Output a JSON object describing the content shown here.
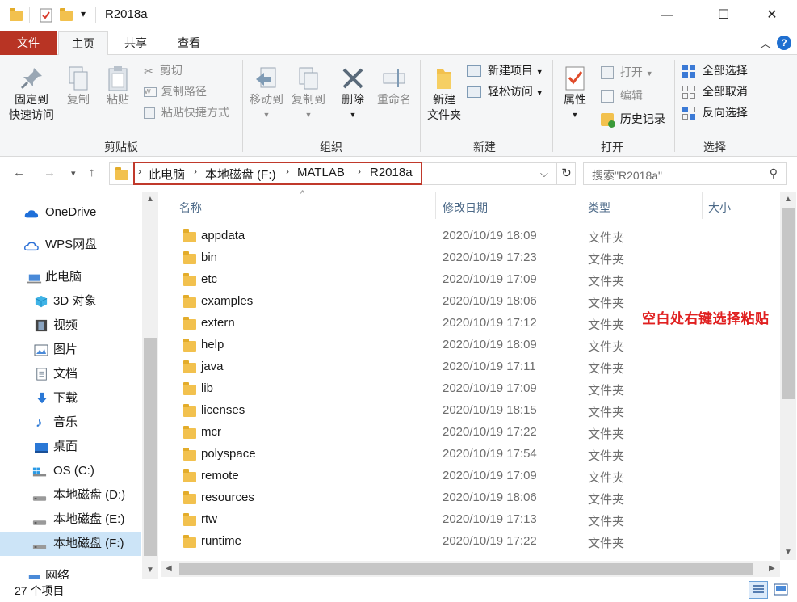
{
  "window": {
    "title": "R2018a",
    "qat_dropdown": "▾",
    "min": "—",
    "max": "☐",
    "close": "✕"
  },
  "ribbon_tabs": {
    "file": "文件",
    "home": "主页",
    "share": "共享",
    "view": "查看"
  },
  "ribbon": {
    "clipboard": {
      "pin": "固定到\n快速访问",
      "pin_line1": "固定到",
      "pin_line2": "快速访问",
      "copy": "复制",
      "paste": "粘贴",
      "cut": "剪切",
      "copy_path": "复制路径",
      "paste_shortcut": "粘贴快捷方式",
      "label": "剪贴板"
    },
    "organize": {
      "move_to": "移动到",
      "copy_to": "复制到",
      "delete": "删除",
      "rename": "重命名",
      "label": "组织"
    },
    "new": {
      "new_folder_line1": "新建",
      "new_folder_line2": "文件夹",
      "new_item": "新建项目",
      "easy_access": "轻松访问",
      "label": "新建"
    },
    "open": {
      "properties": "属性",
      "open": "打开",
      "edit": "编辑",
      "history": "历史记录",
      "label": "打开"
    },
    "select": {
      "select_all": "全部选择",
      "select_none": "全部取消",
      "invert": "反向选择",
      "label": "选择"
    }
  },
  "address": {
    "crumbs": [
      "此电脑",
      "本地磁盘 (F:)",
      "MATLAB",
      "R2018a"
    ],
    "search_placeholder": "搜索\"R2018a\""
  },
  "nav_pane": {
    "items": [
      {
        "label": "OneDrive",
        "icon": "cloud-blue-icon"
      },
      {
        "label": "WPS网盘",
        "icon": "cloud-outline-icon"
      },
      {
        "label": "此电脑",
        "icon": "computer-icon"
      },
      {
        "label": "3D 对象",
        "icon": "cube-icon"
      },
      {
        "label": "视频",
        "icon": "film-icon"
      },
      {
        "label": "图片",
        "icon": "picture-icon"
      },
      {
        "label": "文档",
        "icon": "document-icon"
      },
      {
        "label": "下载",
        "icon": "download-icon"
      },
      {
        "label": "音乐",
        "icon": "music-icon"
      },
      {
        "label": "桌面",
        "icon": "desktop-icon"
      },
      {
        "label": "OS (C:)",
        "icon": "windows-drive-icon"
      },
      {
        "label": "本地磁盘 (D:)",
        "icon": "drive-icon"
      },
      {
        "label": "本地磁盘 (E:)",
        "icon": "drive-icon"
      },
      {
        "label": "本地磁盘 (F:)",
        "icon": "drive-icon"
      },
      {
        "label": "网络",
        "icon": "network-icon"
      }
    ],
    "selected": "本地磁盘 (F:)"
  },
  "file_list": {
    "columns": {
      "name": "名称",
      "date": "修改日期",
      "type": "类型",
      "size": "大小"
    },
    "rows": [
      {
        "name": "appdata",
        "date": "2020/10/19 18:09",
        "type": "文件夹"
      },
      {
        "name": "bin",
        "date": "2020/10/19 17:23",
        "type": "文件夹"
      },
      {
        "name": "etc",
        "date": "2020/10/19 17:09",
        "type": "文件夹"
      },
      {
        "name": "examples",
        "date": "2020/10/19 18:06",
        "type": "文件夹"
      },
      {
        "name": "extern",
        "date": "2020/10/19 17:12",
        "type": "文件夹"
      },
      {
        "name": "help",
        "date": "2020/10/19 18:09",
        "type": "文件夹"
      },
      {
        "name": "java",
        "date": "2020/10/19 17:11",
        "type": "文件夹"
      },
      {
        "name": "lib",
        "date": "2020/10/19 17:09",
        "type": "文件夹"
      },
      {
        "name": "licenses",
        "date": "2020/10/19 18:15",
        "type": "文件夹"
      },
      {
        "name": "mcr",
        "date": "2020/10/19 17:22",
        "type": "文件夹"
      },
      {
        "name": "polyspace",
        "date": "2020/10/19 17:54",
        "type": "文件夹"
      },
      {
        "name": "remote",
        "date": "2020/10/19 17:09",
        "type": "文件夹"
      },
      {
        "name": "resources",
        "date": "2020/10/19 18:06",
        "type": "文件夹"
      },
      {
        "name": "rtw",
        "date": "2020/10/19 17:13",
        "type": "文件夹"
      },
      {
        "name": "runtime",
        "date": "2020/10/19 17:22",
        "type": "文件夹"
      }
    ]
  },
  "annotation": "空白处右键选择粘贴",
  "status": {
    "item_count": "27 个项目"
  },
  "colors": {
    "file_tab": "#b83424",
    "highlight_box": "#c0392b",
    "annotation": "#e02020",
    "selection": "#cce4f7"
  }
}
